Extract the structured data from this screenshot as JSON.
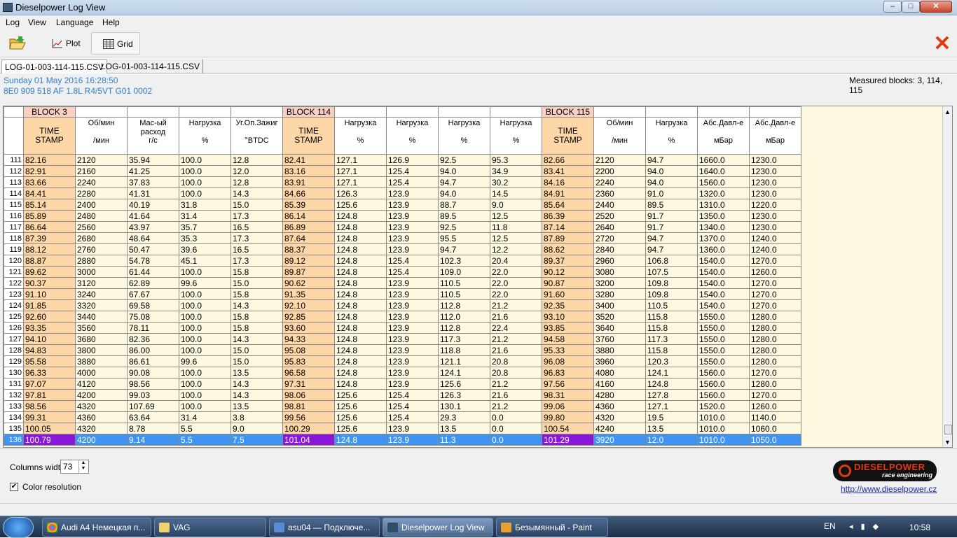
{
  "window": {
    "title": "Dieselpower Log View",
    "min": "–",
    "max": "□",
    "close": "✕"
  },
  "menu": [
    "Log",
    "View",
    "Language",
    "Help"
  ],
  "toolbar": {
    "plot": "Plot",
    "grid": "Grid"
  },
  "tabs": [
    "LOG-01-003-114-115.CSV",
    "LOG-01-003-114-115.CSV"
  ],
  "info": {
    "date": "Sunday 01 May 2016 16:28:50",
    "ecu": "8E0 909 518 AF  1.8L R4/5VT     G01 0002",
    "measured": "Measured blocks: 3, 114, 115"
  },
  "grid": {
    "blocks": [
      "BLOCK 3",
      "BLOCK 114",
      "BLOCK 115"
    ],
    "columns": [
      {
        "h": "TIME\nSTAMP",
        "u": "",
        "ts": true
      },
      {
        "h": "Об/мин",
        "u": "/мин"
      },
      {
        "h": "Мас-ый\nрасход",
        "u": "г/с"
      },
      {
        "h": "Нагрузка",
        "u": "%"
      },
      {
        "h": "Уг.Оп.Зажиг",
        "u": "°BTDC"
      },
      {
        "h": "TIME\nSTAMP",
        "u": "",
        "ts": true
      },
      {
        "h": "Нагрузка",
        "u": "%"
      },
      {
        "h": "Нагрузка",
        "u": "%"
      },
      {
        "h": "Нагрузка",
        "u": "%"
      },
      {
        "h": "Нагрузка",
        "u": "%"
      },
      {
        "h": "TIME\nSTAMP",
        "u": "",
        "ts": true
      },
      {
        "h": "Об/мин",
        "u": "/мин"
      },
      {
        "h": "Нагрузка",
        "u": "%"
      },
      {
        "h": "Абс.Давл-е",
        "u": "мБар"
      },
      {
        "h": "Абс.Давл-е",
        "u": "мБар"
      }
    ],
    "rows": [
      [
        "111",
        "82.16",
        "2120",
        "35.94",
        "100.0",
        "12.8",
        "82.41",
        "127.1",
        "126.9",
        "92.5",
        "95.3",
        "82.66",
        "2120",
        "94.7",
        "1660.0",
        "1230.0"
      ],
      [
        "112",
        "82.91",
        "2160",
        "41.25",
        "100.0",
        "12.0",
        "83.16",
        "127.1",
        "125.4",
        "94.0",
        "34.9",
        "83.41",
        "2200",
        "94.0",
        "1640.0",
        "1230.0"
      ],
      [
        "113",
        "83.66",
        "2240",
        "37.83",
        "100.0",
        "12.8",
        "83.91",
        "127.1",
        "125.4",
        "94.7",
        "30.2",
        "84.16",
        "2240",
        "94.0",
        "1560.0",
        "1230.0"
      ],
      [
        "114",
        "84.41",
        "2280",
        "41.31",
        "100.0",
        "14.3",
        "84.66",
        "126.3",
        "123.9",
        "94.0",
        "14.5",
        "84.91",
        "2360",
        "91.0",
        "1320.0",
        "1230.0"
      ],
      [
        "115",
        "85.14",
        "2400",
        "40.19",
        "31.8",
        "15.0",
        "85.39",
        "125.6",
        "123.9",
        "88.7",
        "9.0",
        "85.64",
        "2440",
        "89.5",
        "1310.0",
        "1220.0"
      ],
      [
        "116",
        "85.89",
        "2480",
        "41.64",
        "31.4",
        "17.3",
        "86.14",
        "124.8",
        "123.9",
        "89.5",
        "12.5",
        "86.39",
        "2520",
        "91.7",
        "1350.0",
        "1230.0"
      ],
      [
        "117",
        "86.64",
        "2560",
        "43.97",
        "35.7",
        "16.5",
        "86.89",
        "124.8",
        "123.9",
        "92.5",
        "11.8",
        "87.14",
        "2640",
        "91.7",
        "1340.0",
        "1230.0"
      ],
      [
        "118",
        "87.39",
        "2680",
        "48.64",
        "35.3",
        "17.3",
        "87.64",
        "124.8",
        "123.9",
        "95.5",
        "12.5",
        "87.89",
        "2720",
        "94.7",
        "1370.0",
        "1240.0"
      ],
      [
        "119",
        "88.12",
        "2760",
        "50.47",
        "39.6",
        "16.5",
        "88.37",
        "124.8",
        "123.9",
        "94.7",
        "12.2",
        "88.62",
        "2840",
        "94.7",
        "1360.0",
        "1240.0"
      ],
      [
        "120",
        "88.87",
        "2880",
        "54.78",
        "45.1",
        "17.3",
        "89.12",
        "124.8",
        "125.4",
        "102.3",
        "20.4",
        "89.37",
        "2960",
        "106.8",
        "1540.0",
        "1270.0"
      ],
      [
        "121",
        "89.62",
        "3000",
        "61.44",
        "100.0",
        "15.8",
        "89.87",
        "124.8",
        "125.4",
        "109.0",
        "22.0",
        "90.12",
        "3080",
        "107.5",
        "1540.0",
        "1260.0"
      ],
      [
        "122",
        "90.37",
        "3120",
        "62.89",
        "99.6",
        "15.0",
        "90.62",
        "124.8",
        "123.9",
        "110.5",
        "22.0",
        "90.87",
        "3200",
        "109.8",
        "1540.0",
        "1270.0"
      ],
      [
        "123",
        "91.10",
        "3240",
        "67.67",
        "100.0",
        "15.8",
        "91.35",
        "124.8",
        "123.9",
        "110.5",
        "22.0",
        "91.60",
        "3280",
        "109.8",
        "1540.0",
        "1270.0"
      ],
      [
        "124",
        "91.85",
        "3320",
        "69.58",
        "100.0",
        "14.3",
        "92.10",
        "124.8",
        "123.9",
        "112.8",
        "21.2",
        "92.35",
        "3400",
        "110.5",
        "1540.0",
        "1270.0"
      ],
      [
        "125",
        "92.60",
        "3440",
        "75.08",
        "100.0",
        "15.8",
        "92.85",
        "124.8",
        "123.9",
        "112.0",
        "21.6",
        "93.10",
        "3520",
        "115.8",
        "1550.0",
        "1280.0"
      ],
      [
        "126",
        "93.35",
        "3560",
        "78.11",
        "100.0",
        "15.8",
        "93.60",
        "124.8",
        "123.9",
        "112.8",
        "22.4",
        "93.85",
        "3640",
        "115.8",
        "1550.0",
        "1280.0"
      ],
      [
        "127",
        "94.10",
        "3680",
        "82.36",
        "100.0",
        "14.3",
        "94.33",
        "124.8",
        "123.9",
        "117.3",
        "21.2",
        "94.58",
        "3760",
        "117.3",
        "1550.0",
        "1280.0"
      ],
      [
        "128",
        "94.83",
        "3800",
        "86.00",
        "100.0",
        "15.0",
        "95.08",
        "124.8",
        "123.9",
        "118.8",
        "21.6",
        "95.33",
        "3880",
        "115.8",
        "1550.0",
        "1280.0"
      ],
      [
        "129",
        "95.58",
        "3880",
        "86.61",
        "99.6",
        "15.0",
        "95.83",
        "124.8",
        "123.9",
        "121.1",
        "20.8",
        "96.08",
        "3960",
        "120.3",
        "1550.0",
        "1280.0"
      ],
      [
        "130",
        "96.33",
        "4000",
        "90.08",
        "100.0",
        "13.5",
        "96.58",
        "124.8",
        "123.9",
        "124.1",
        "20.8",
        "96.83",
        "4080",
        "124.1",
        "1560.0",
        "1270.0"
      ],
      [
        "131",
        "97.07",
        "4120",
        "98.56",
        "100.0",
        "14.3",
        "97.31",
        "124.8",
        "123.9",
        "125.6",
        "21.2",
        "97.56",
        "4160",
        "124.8",
        "1560.0",
        "1280.0"
      ],
      [
        "132",
        "97.81",
        "4200",
        "99.03",
        "100.0",
        "14.3",
        "98.06",
        "125.6",
        "125.4",
        "126.3",
        "21.6",
        "98.31",
        "4280",
        "127.8",
        "1560.0",
        "1270.0"
      ],
      [
        "133",
        "98.56",
        "4320",
        "107.69",
        "100.0",
        "13.5",
        "98.81",
        "125.6",
        "125.4",
        "130.1",
        "21.2",
        "99.06",
        "4360",
        "127.1",
        "1520.0",
        "1260.0"
      ],
      [
        "134",
        "99.31",
        "4360",
        "63.64",
        "31.4",
        "3.8",
        "99.56",
        "125.6",
        "125.4",
        "29.3",
        "0.0",
        "99.80",
        "4320",
        "19.5",
        "1010.0",
        "1140.0"
      ],
      [
        "135",
        "100.05",
        "4320",
        "8.78",
        "5.5",
        "9.0",
        "100.29",
        "125.6",
        "123.9",
        "13.5",
        "0.0",
        "100.54",
        "4240",
        "13.5",
        "1010.0",
        "1060.0"
      ],
      [
        "136",
        "100.79",
        "4200",
        "9.14",
        "5.5",
        "7.5",
        "101.04",
        "124.8",
        "123.9",
        "11.3",
        "0.0",
        "101.29",
        "3920",
        "12.0",
        "1010.0",
        "1050.0"
      ]
    ]
  },
  "bottom": {
    "columns_width_label": "Columns width:",
    "columns_width": "73",
    "color_label": "Color resolution",
    "logo": "DIESELPOWER",
    "logo_sub": "race engineering",
    "url": "http://www.dieselpower.cz"
  },
  "taskbar": {
    "items": [
      "Audi A4 Немецкая п...",
      "VAG",
      "asu04 — Подключе...",
      "Dieselpower Log View",
      "Безымянный - Paint"
    ],
    "lang": "EN",
    "time": "10:58"
  }
}
